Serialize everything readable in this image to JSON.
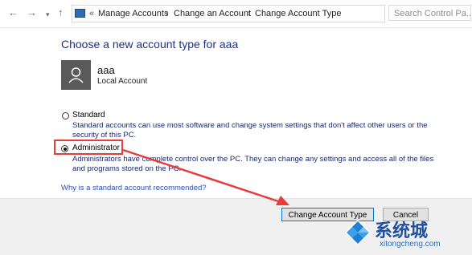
{
  "address_bar": {
    "back_icon": "arrow-left-icon",
    "forward_icon": "arrow-right-icon",
    "recent_icon": "chevron-down-icon",
    "up_icon": "arrow-up-icon",
    "prefix": "«",
    "breadcrumbs": [
      "Manage Accounts",
      "Change an Account",
      "Change Account Type"
    ],
    "separator": "›",
    "search_placeholder": "Search Control Pa..."
  },
  "main": {
    "heading": "Choose a new account type for aaa",
    "account": {
      "name": "aaa",
      "type": "Local Account"
    },
    "options": [
      {
        "label": "Standard",
        "description": "Standard accounts can use most software and change system settings that don't affect other users or the security of this PC.",
        "selected": false
      },
      {
        "label": "Administrator",
        "description": "Administrators have complete control over the PC. They can change any settings and access all of the files and programs stored on the PC.",
        "selected": true
      }
    ],
    "help_link": "Why is a standard account recommended?"
  },
  "footer": {
    "change_button": "Change Account Type",
    "cancel_button": "Cancel"
  },
  "watermark": {
    "title": "系统城",
    "url": "xitongcheng.com"
  },
  "colors": {
    "heading": "#1e3287",
    "link": "#2a4fb4",
    "highlight": "#e53c3c",
    "footer_bg": "#f0f0f0"
  }
}
